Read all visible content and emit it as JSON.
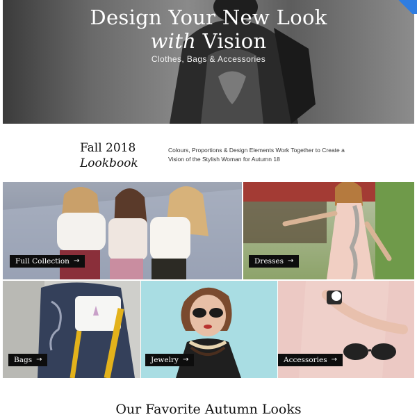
{
  "hero": {
    "title_line1": "Design Your New Look",
    "title_line2_italic": "with",
    "title_line2_rest": " Vision",
    "subtitle": "Clothes, Bags & Accessories"
  },
  "intro": {
    "title_line1": "Fall 2018",
    "title_line2": "Lookbook",
    "description": "Colours, Proportions & Design Elements Work Together to Create a Vision of the Stylish Woman for Autumn 18"
  },
  "tiles": [
    {
      "label": "Full Collection",
      "arrow": "→"
    },
    {
      "label": "Dresses",
      "arrow": "→"
    },
    {
      "label": "Bags",
      "arrow": "→"
    },
    {
      "label": "Jewelry",
      "arrow": "→"
    },
    {
      "label": "Accessories",
      "arrow": "→"
    }
  ],
  "section": {
    "title": "Our Favorite Autumn Looks"
  },
  "colors": {
    "accent": "#2f7de1",
    "label_bg": "#0d0d0d"
  }
}
